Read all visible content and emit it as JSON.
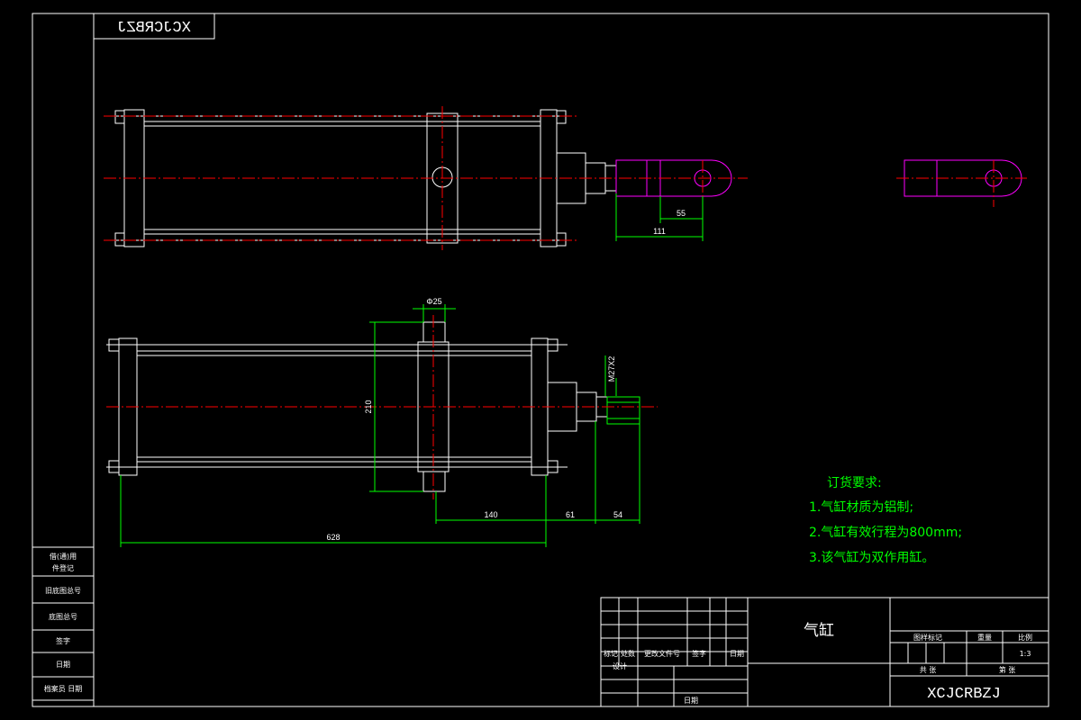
{
  "drawing_code": "XCJCRBZJ",
  "drawing_code_mirrored": "XCJCRBZJ",
  "part_name": "气缸",
  "scale": "1:3",
  "dimensions": {
    "top_view": {
      "d1": "55",
      "d2": "111"
    },
    "bottom_view": {
      "bore": "Φ25",
      "height": "210",
      "thread": "M27X2",
      "seg1": "140",
      "seg2": "61",
      "seg3": "54",
      "overall": "628"
    }
  },
  "requirements": {
    "title": "订货要求:",
    "items": [
      "1.气缸材质为铝制;",
      "2.气缸有效行程为800mm;",
      "3.该气缸为双作用缸。"
    ]
  },
  "side_stamp": {
    "rows": [
      "借(通)用",
      "件登记",
      "旧底图总号",
      "底图总号",
      "签字",
      "日期",
      "档案员 日期"
    ]
  },
  "title_block": {
    "revision_headers": [
      "标记",
      "处数",
      "更改文件号",
      "签字",
      "日期"
    ],
    "design_label": "设计",
    "date_label": "日期",
    "stage_headers": [
      "图样标记",
      "重量",
      "比例"
    ],
    "sheet_labels": [
      "共 张",
      "第 张"
    ]
  },
  "colors": {
    "background": "#000000",
    "outline": "#ffffff",
    "centerline": "#ff0000",
    "dimension": "#00ff00",
    "rod_end": "#ff00ff"
  }
}
